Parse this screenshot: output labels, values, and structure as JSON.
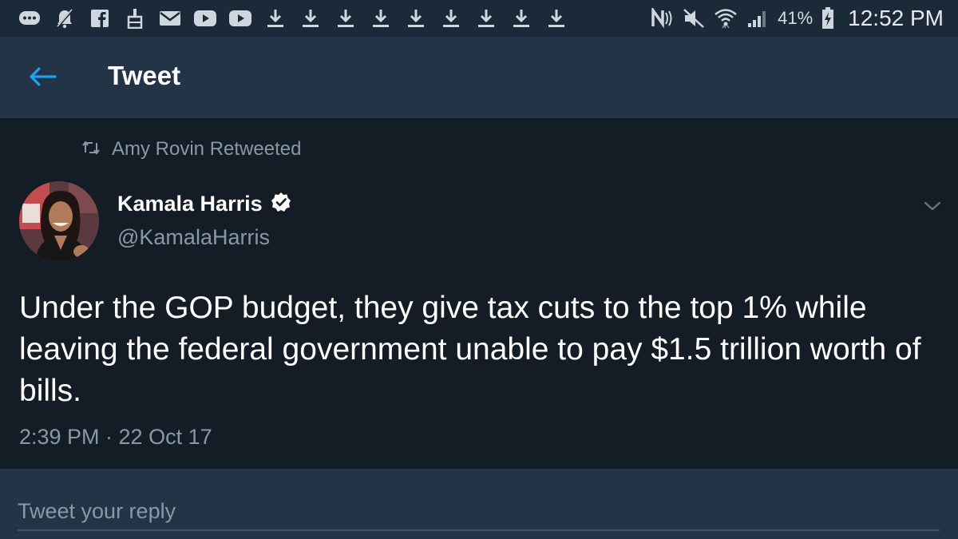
{
  "status_bar": {
    "icons": [
      "chat-bubble-icon",
      "mute-bell-icon",
      "facebook-icon",
      "cleaner-icon",
      "email-icon",
      "youtube-icon",
      "youtube-icon",
      "download-icon",
      "download-icon",
      "download-icon",
      "download-icon",
      "download-icon",
      "download-icon",
      "download-icon",
      "download-icon",
      "download-icon"
    ],
    "right_icons": [
      "nfc-icon",
      "silent-icon",
      "wifi-icon",
      "signal-icon"
    ],
    "battery": "41%",
    "time": "12:52 PM"
  },
  "app_bar": {
    "title": "Tweet",
    "accent": "#1da1f2"
  },
  "tweet": {
    "retweeted_by": "Amy Rovin Retweeted",
    "author_name": "Kamala Harris",
    "verified": true,
    "handle": "@KamalaHarris",
    "text": "Under the GOP budget, they give tax cuts to the top 1% while leaving the federal government unable to pay $1.5 trillion worth of bills.",
    "timestamp": "2:39 PM · 22 Oct 17"
  },
  "reply": {
    "placeholder": "Tweet your reply",
    "value": ""
  },
  "colors": {
    "background": "#141d26",
    "bar": "#243447",
    "status_bar": "#1c2938",
    "secondary_text": "#8899a6"
  }
}
